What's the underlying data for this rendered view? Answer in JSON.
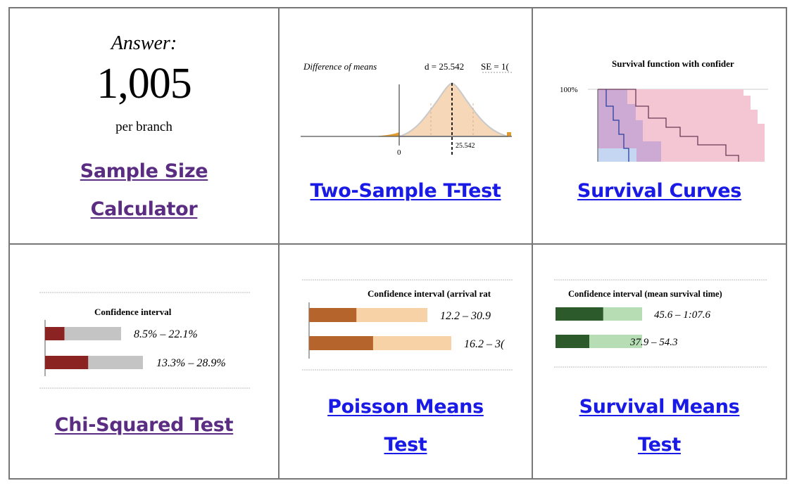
{
  "tiles": [
    {
      "answer_label": "Answer:",
      "answer_value": "1,005",
      "answer_unit": "per branch",
      "link_line1": "Sample Size",
      "link_line2": "Calculator",
      "link_color": "#5a2d82"
    },
    {
      "thumb_title": "Difference of means",
      "thumb_stat_d": "d = 25.542",
      "thumb_stat_se": "SE = 1(",
      "thumb_tick_zero": "0",
      "thumb_tick_d": "25.542",
      "link_line1": "Two-Sample T-Test",
      "link_color": "#1a1ae6"
    },
    {
      "thumb_title": "Survival function with confider",
      "thumb_axis_label": "100%",
      "link_line1": "Survival Curves",
      "link_color": "#1a1ae6"
    },
    {
      "thumb_title": "Confidence interval",
      "ranges": [
        "8.5% – 22.1%",
        "13.3% – 28.9%"
      ],
      "bar_color": "#8b2323",
      "bar_bg_color": "#c4c4c4",
      "bars": [
        {
          "value": 0.255
        },
        {
          "value": 0.44
        }
      ],
      "link_line1": "Chi-Squared Test",
      "link_color": "#5a2d82"
    },
    {
      "thumb_title": "Confidence interval (arrival rat",
      "ranges": [
        "12.2 – 30.9",
        "16.2 – 3("
      ],
      "bar_color": "#b5652b",
      "bar_bg_color": "#f7d2a6",
      "bars": [
        {
          "value": 0.4
        },
        {
          "value": 0.45
        }
      ],
      "link_line1": "Poisson Means",
      "link_line2": "Test",
      "link_color": "#1a1ae6"
    },
    {
      "thumb_title": "Confidence interval (mean survival time)",
      "ranges": [
        "45.6 – 1:07.6",
        "37.9 – 54.3"
      ],
      "bar_color": "#2d5a2a",
      "bar_bg_color": "#b7ddb5",
      "bars": [
        {
          "value": 0.55
        },
        {
          "value": 0.39
        }
      ],
      "link_line1": "Survival Means",
      "link_line2": "Test",
      "link_color": "#1a1ae6"
    }
  ]
}
